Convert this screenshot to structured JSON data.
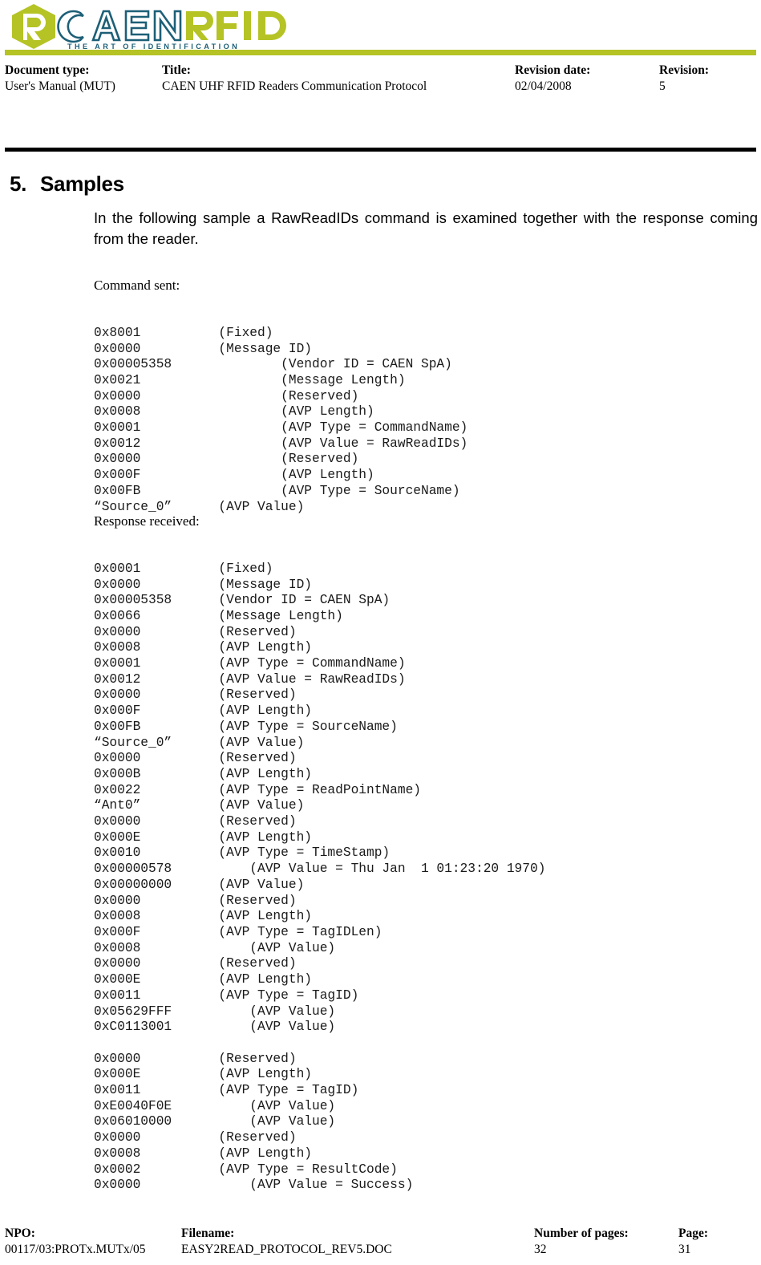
{
  "logo": {
    "mark_letter": "R",
    "word_outline": "CAEN",
    "word_solid": "RFID",
    "tagline": "THE ART OF IDENTIFICATION",
    "olive": "#b5c325",
    "teal": "#1d5f77"
  },
  "header": {
    "doctype_label": "Document type:",
    "doctype_value": "User's Manual (MUT)",
    "title_label": "Title:",
    "title_value": "CAEN UHF RFID Readers Communication Protocol",
    "revdate_label": "Revision date:",
    "revdate_value": "02/04/2008",
    "rev_label": "Revision:",
    "rev_value": "5"
  },
  "section": {
    "number": "5.",
    "title": "Samples",
    "intro": "In the following sample a RawReadIDs command is examined together with the response coming from the reader."
  },
  "command_block": {
    "heading": "Command sent:",
    "lines": "0x8001          (Fixed)\n0x0000          (Message ID)\n0x00005358              (Vendor ID = CAEN SpA)\n0x0021                  (Message Length)\n0x0000                  (Reserved)\n0x0008                  (AVP Length)\n0x0001                  (AVP Type = CommandName)\n0x0012                  (AVP Value = RawReadIDs)\n0x0000                  (Reserved)\n0x000F                  (AVP Length)\n0x00FB                  (AVP Type = SourceName)\n“Source_0”      (AVP Value)"
  },
  "response_block": {
    "heading": "Response received:",
    "lines": "0x0001          (Fixed)\n0x0000          (Message ID)\n0x00005358      (Vendor ID = CAEN SpA)\n0x0066          (Message Length)\n0x0000          (Reserved)\n0x0008          (AVP Length)\n0x0001          (AVP Type = CommandName)\n0x0012          (AVP Value = RawReadIDs)\n0x0000          (Reserved)\n0x000F          (AVP Length)\n0x00FB          (AVP Type = SourceName)\n“Source_0”      (AVP Value)\n0x0000          (Reserved)\n0x000B          (AVP Length)\n0x0022          (AVP Type = ReadPointName)\n“Ant0”          (AVP Value)\n0x0000          (Reserved)\n0x000E          (AVP Length)\n0x0010          (AVP Type = TimeStamp)\n0x00000578          (AVP Value = Thu Jan  1 01:23:20 1970)\n0x00000000      (AVP Value)\n0x0000          (Reserved)\n0x0008          (AVP Length)\n0x000F          (AVP Type = TagIDLen)\n0x0008              (AVP Value)\n0x0000          (Reserved)\n0x000E          (AVP Length)\n0x0011          (AVP Type = TagID)\n0x05629FFF          (AVP Value)\n0xC0113001          (AVP Value)\n\n0x0000          (Reserved)\n0x000E          (AVP Length)\n0x0011          (AVP Type = TagID)\n0xE0040F0E          (AVP Value)\n0x06010000          (AVP Value)\n0x0000          (Reserved)\n0x0008          (AVP Length)\n0x0002          (AVP Type = ResultCode)\n0x0000              (AVP Value = Success)"
  },
  "footer": {
    "npo_label": "NPO:",
    "npo_value": "00117/03:PROTx.MUTx/05",
    "filename_label": "Filename:",
    "filename_value": "EASY2READ_PROTOCOL_REV5.DOC",
    "numpages_label": "Number of pages:",
    "numpages_value": "32",
    "page_label": "Page:",
    "page_value": "31"
  }
}
